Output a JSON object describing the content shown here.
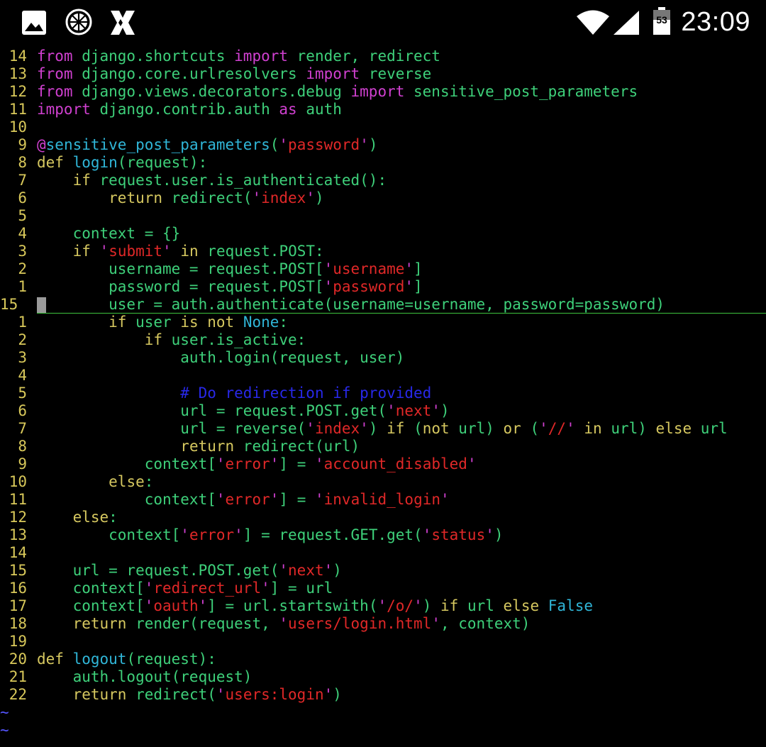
{
  "status_bar": {
    "time": "23:09",
    "battery_level": "53",
    "icons": [
      "gallery-icon",
      "orange-slice-icon",
      "app-x-icon",
      "wifi-icon",
      "signal-icon",
      "battery-icon"
    ]
  },
  "editor": {
    "cursor_line_number": "15",
    "tilde_lines": 2,
    "lines": [
      {
        "num": "14",
        "tokens": [
          [
            "kw",
            "from"
          ],
          [
            "tx",
            " django.shortcuts "
          ],
          [
            "kw",
            "import"
          ],
          [
            "tx",
            " render, redirect"
          ]
        ]
      },
      {
        "num": "13",
        "tokens": [
          [
            "kw",
            "from"
          ],
          [
            "tx",
            " django.core.urlresolvers "
          ],
          [
            "kw",
            "import"
          ],
          [
            "tx",
            " reverse"
          ]
        ]
      },
      {
        "num": "12",
        "tokens": [
          [
            "kw",
            "from"
          ],
          [
            "tx",
            " django.views.decorators.debug "
          ],
          [
            "kw",
            "import"
          ],
          [
            "tx",
            " sensitive_post_parameters"
          ]
        ]
      },
      {
        "num": "11",
        "tokens": [
          [
            "kw",
            "import"
          ],
          [
            "tx",
            " django.contrib.auth "
          ],
          [
            "kw",
            "as"
          ],
          [
            "tx",
            " auth"
          ]
        ]
      },
      {
        "num": "10",
        "tokens": []
      },
      {
        "num": "9",
        "tokens": [
          [
            "q",
            "@"
          ],
          [
            "fn",
            "sensitive_post_parameters"
          ],
          [
            "tx",
            "("
          ],
          [
            "q",
            "'"
          ],
          [
            "str",
            "password"
          ],
          [
            "q",
            "'"
          ],
          [
            "tx",
            ")"
          ]
        ]
      },
      {
        "num": "8",
        "tokens": [
          [
            "st",
            "def "
          ],
          [
            "fn",
            "login"
          ],
          [
            "tx",
            "(request):"
          ]
        ]
      },
      {
        "num": "7",
        "tokens": [
          [
            "tx",
            "    "
          ],
          [
            "st",
            "if"
          ],
          [
            "tx",
            " request.user.is_authenticated():"
          ]
        ]
      },
      {
        "num": "6",
        "tokens": [
          [
            "tx",
            "        "
          ],
          [
            "st",
            "return"
          ],
          [
            "tx",
            " redirect("
          ],
          [
            "q",
            "'"
          ],
          [
            "str",
            "index"
          ],
          [
            "q",
            "'"
          ],
          [
            "tx",
            ")"
          ]
        ]
      },
      {
        "num": "5",
        "tokens": []
      },
      {
        "num": "4",
        "tokens": [
          [
            "tx",
            "    context = {}"
          ]
        ]
      },
      {
        "num": "3",
        "tokens": [
          [
            "tx",
            "    "
          ],
          [
            "st",
            "if"
          ],
          [
            "tx",
            " "
          ],
          [
            "q",
            "'"
          ],
          [
            "str",
            "submit"
          ],
          [
            "q",
            "'"
          ],
          [
            "tx",
            " "
          ],
          [
            "st",
            "in"
          ],
          [
            "tx",
            " request.POST:"
          ]
        ]
      },
      {
        "num": "2",
        "tokens": [
          [
            "tx",
            "        username = request.POST["
          ],
          [
            "q",
            "'"
          ],
          [
            "str",
            "username"
          ],
          [
            "q",
            "'"
          ],
          [
            "tx",
            "]"
          ]
        ]
      },
      {
        "num": "1",
        "tokens": [
          [
            "tx",
            "        password = request.POST["
          ],
          [
            "q",
            "'"
          ],
          [
            "str",
            "password"
          ],
          [
            "q",
            "'"
          ],
          [
            "tx",
            "]"
          ]
        ]
      },
      {
        "num": "15",
        "current": true,
        "tokens": [
          [
            "tx",
            "        user = auth.authenticate(username=username, password=password)"
          ]
        ]
      },
      {
        "num": "1",
        "tokens": [
          [
            "tx",
            "        "
          ],
          [
            "st",
            "if"
          ],
          [
            "tx",
            " user "
          ],
          [
            "st",
            "is not"
          ],
          [
            "tx",
            " "
          ],
          [
            "cn",
            "None"
          ],
          [
            "tx",
            ":"
          ]
        ]
      },
      {
        "num": "2",
        "tokens": [
          [
            "tx",
            "            "
          ],
          [
            "st",
            "if"
          ],
          [
            "tx",
            " user.is_active:"
          ]
        ]
      },
      {
        "num": "3",
        "tokens": [
          [
            "tx",
            "                auth.login(request, user)"
          ]
        ]
      },
      {
        "num": "4",
        "tokens": []
      },
      {
        "num": "5",
        "tokens": [
          [
            "tx",
            "                "
          ],
          [
            "cm",
            "# Do redirection if provided"
          ]
        ]
      },
      {
        "num": "6",
        "tokens": [
          [
            "tx",
            "                url = request.POST.get("
          ],
          [
            "q",
            "'"
          ],
          [
            "str",
            "next"
          ],
          [
            "q",
            "'"
          ],
          [
            "tx",
            ")"
          ]
        ]
      },
      {
        "num": "7",
        "tokens": [
          [
            "tx",
            "                url = reverse("
          ],
          [
            "q",
            "'"
          ],
          [
            "str",
            "index"
          ],
          [
            "q",
            "'"
          ],
          [
            "tx",
            ") "
          ],
          [
            "st",
            "if"
          ],
          [
            "tx",
            " ("
          ],
          [
            "st",
            "not"
          ],
          [
            "tx",
            " url) "
          ],
          [
            "st",
            "or"
          ],
          [
            "tx",
            " ("
          ],
          [
            "q",
            "'"
          ],
          [
            "str",
            "//"
          ],
          [
            "q",
            "'"
          ],
          [
            "tx",
            " "
          ],
          [
            "st",
            "in"
          ],
          [
            "tx",
            " url) "
          ],
          [
            "st",
            "else"
          ],
          [
            "tx",
            " url"
          ]
        ]
      },
      {
        "num": "8",
        "tokens": [
          [
            "tx",
            "                "
          ],
          [
            "st",
            "return"
          ],
          [
            "tx",
            " redirect(url)"
          ]
        ]
      },
      {
        "num": "9",
        "tokens": [
          [
            "tx",
            "            context["
          ],
          [
            "q",
            "'"
          ],
          [
            "str",
            "error"
          ],
          [
            "q",
            "'"
          ],
          [
            "tx",
            "] = "
          ],
          [
            "q",
            "'"
          ],
          [
            "str",
            "account_disabled"
          ],
          [
            "q",
            "'"
          ]
        ]
      },
      {
        "num": "10",
        "tokens": [
          [
            "tx",
            "        "
          ],
          [
            "st",
            "else"
          ],
          [
            "tx",
            ":"
          ]
        ]
      },
      {
        "num": "11",
        "tokens": [
          [
            "tx",
            "            context["
          ],
          [
            "q",
            "'"
          ],
          [
            "str",
            "error"
          ],
          [
            "q",
            "'"
          ],
          [
            "tx",
            "] = "
          ],
          [
            "q",
            "'"
          ],
          [
            "str",
            "invalid_login"
          ],
          [
            "q",
            "'"
          ]
        ]
      },
      {
        "num": "12",
        "tokens": [
          [
            "tx",
            "    "
          ],
          [
            "st",
            "else"
          ],
          [
            "tx",
            ":"
          ]
        ]
      },
      {
        "num": "13",
        "tokens": [
          [
            "tx",
            "        context["
          ],
          [
            "q",
            "'"
          ],
          [
            "str",
            "error"
          ],
          [
            "q",
            "'"
          ],
          [
            "tx",
            "] = request.GET.get("
          ],
          [
            "q",
            "'"
          ],
          [
            "str",
            "status"
          ],
          [
            "q",
            "'"
          ],
          [
            "tx",
            ")"
          ]
        ]
      },
      {
        "num": "14",
        "tokens": []
      },
      {
        "num": "15",
        "tokens": [
          [
            "tx",
            "    url = request.POST.get("
          ],
          [
            "q",
            "'"
          ],
          [
            "str",
            "next"
          ],
          [
            "q",
            "'"
          ],
          [
            "tx",
            ")"
          ]
        ]
      },
      {
        "num": "16",
        "tokens": [
          [
            "tx",
            "    context["
          ],
          [
            "q",
            "'"
          ],
          [
            "str",
            "redirect_url"
          ],
          [
            "q",
            "'"
          ],
          [
            "tx",
            "] = url"
          ]
        ]
      },
      {
        "num": "17",
        "tokens": [
          [
            "tx",
            "    context["
          ],
          [
            "q",
            "'"
          ],
          [
            "str",
            "oauth"
          ],
          [
            "q",
            "'"
          ],
          [
            "tx",
            "] = url.startswith("
          ],
          [
            "q",
            "'"
          ],
          [
            "str",
            "/o/"
          ],
          [
            "q",
            "'"
          ],
          [
            "tx",
            ") "
          ],
          [
            "st",
            "if"
          ],
          [
            "tx",
            " url "
          ],
          [
            "st",
            "else"
          ],
          [
            "tx",
            " "
          ],
          [
            "cn",
            "False"
          ]
        ]
      },
      {
        "num": "18",
        "tokens": [
          [
            "tx",
            "    "
          ],
          [
            "st",
            "return"
          ],
          [
            "tx",
            " render(request, "
          ],
          [
            "q",
            "'"
          ],
          [
            "str",
            "users/login.html"
          ],
          [
            "q",
            "'"
          ],
          [
            "tx",
            ", context)"
          ]
        ]
      },
      {
        "num": "19",
        "tokens": []
      },
      {
        "num": "20",
        "tokens": [
          [
            "st",
            "def "
          ],
          [
            "fn",
            "logout"
          ],
          [
            "tx",
            "(request):"
          ]
        ]
      },
      {
        "num": "21",
        "tokens": [
          [
            "tx",
            "    auth.logout(request)"
          ]
        ]
      },
      {
        "num": "22",
        "tokens": [
          [
            "tx",
            "    "
          ],
          [
            "st",
            "return"
          ],
          [
            "tx",
            " redirect("
          ],
          [
            "q",
            "'"
          ],
          [
            "str",
            "users:login"
          ],
          [
            "q",
            "'"
          ],
          [
            "tx",
            ")"
          ]
        ]
      }
    ],
    "tilde_char": "~"
  }
}
